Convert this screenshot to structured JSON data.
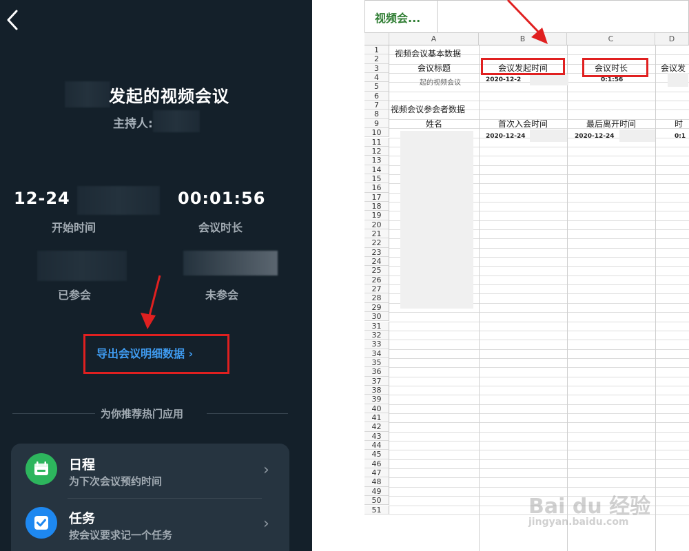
{
  "phone": {
    "title_suffix": "发起的视频会议",
    "host_label": "主持人:",
    "stats": {
      "start_time_value": "12-24",
      "start_time_label": "开始时间",
      "duration_value": "00:01:56",
      "duration_label": "会议时长",
      "joined_label": "已参会",
      "not_joined_label": "未参会"
    },
    "export_link": "导出会议明细数据 ›",
    "recommend_divider": "为你推荐热门应用",
    "apps": [
      {
        "title": "日程",
        "desc": "为下次会议预约时间",
        "color": "#2db55d"
      },
      {
        "title": "任务",
        "desc": "按会议要求记一个任务",
        "color": "#1e88f0"
      }
    ],
    "chevron": "›"
  },
  "sheet": {
    "tab_label": "视频会...",
    "columns": [
      "A",
      "B",
      "C",
      "D"
    ],
    "rows": [
      "1",
      "2",
      "3",
      "4",
      "5",
      "6",
      "7",
      "8",
      "9",
      "10",
      "11",
      "12",
      "13",
      "14",
      "15",
      "16",
      "17",
      "18",
      "19",
      "20",
      "21",
      "22",
      "23",
      "24",
      "25",
      "26",
      "27",
      "28",
      "29",
      "30",
      "31",
      "32",
      "33",
      "34",
      "35",
      "36",
      "37",
      "38",
      "39",
      "40",
      "41",
      "42",
      "43",
      "44",
      "45",
      "46",
      "47",
      "48",
      "49",
      "50",
      "51"
    ],
    "cells": {
      "a1": "视频会议基本数据",
      "a2": "会议标题",
      "b2": "会议发起时间",
      "c2": "会议时长",
      "d2": "会议发",
      "a3": "起的视频会议",
      "b3": "2020-12-2",
      "c3": "0:1:56",
      "a5": "视频会议参会者数据",
      "a6": "姓名",
      "b6": "首次入会时间",
      "c6": "最后离开时间",
      "d6": "时",
      "b7": "2020-12-24",
      "c7": "2020-12-24",
      "d7": "0:1"
    },
    "watermark_main": "Bai du 经验",
    "watermark_sub": "jingyan.baidu.com"
  },
  "colors": {
    "phone_bg": "#14202a",
    "highlight_red": "#e02020",
    "link_blue": "#3f9bf0"
  }
}
